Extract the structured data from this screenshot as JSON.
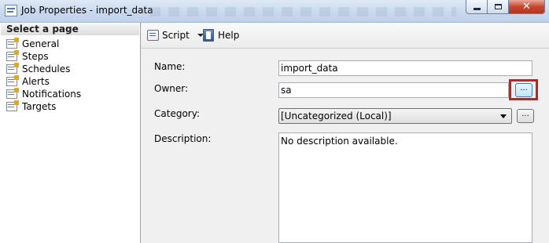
{
  "window": {
    "title": "Job Properties - import_data",
    "controls": [
      "minimize-icon",
      "maximize-icon",
      "close-icon"
    ]
  },
  "sidebar": {
    "header": "Select a page",
    "items": [
      {
        "label": "General",
        "icon": "page-icon"
      },
      {
        "label": "Steps",
        "icon": "page-icon"
      },
      {
        "label": "Schedules",
        "icon": "page-icon"
      },
      {
        "label": "Alerts",
        "icon": "page-icon"
      },
      {
        "label": "Notifications",
        "icon": "page-icon"
      },
      {
        "label": "Targets",
        "icon": "page-icon"
      }
    ]
  },
  "toolbar": {
    "script_label": "Script",
    "help_label": "Help"
  },
  "form": {
    "name_label": "Name:",
    "name_value": "import_data",
    "owner_label": "Owner:",
    "owner_value": "sa",
    "owner_browse": "...",
    "category_label": "Category:",
    "category_value": "[Uncategorized (Local)]",
    "category_browse": "...",
    "description_label": "Description:",
    "description_value": "No description available."
  },
  "colors": {
    "highlight": "#d41b1b",
    "close_button": "#c7472d"
  }
}
